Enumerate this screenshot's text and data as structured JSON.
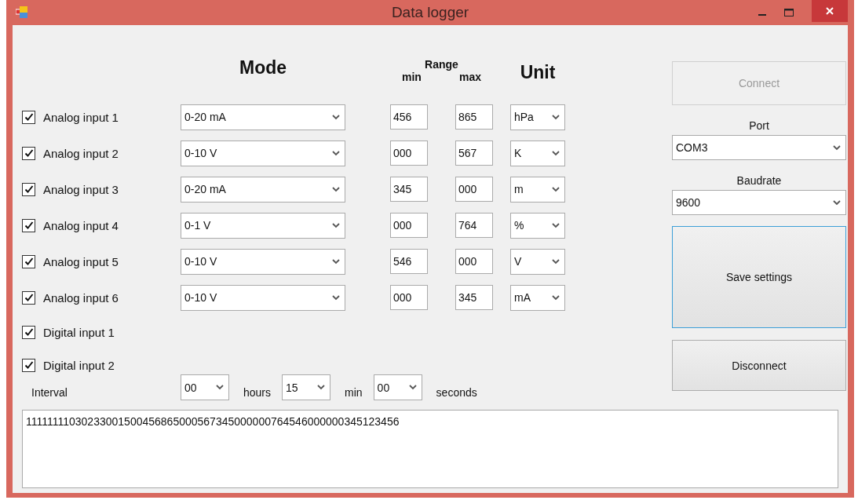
{
  "window": {
    "title": "Data logger"
  },
  "headers": {
    "mode": "Mode",
    "range": "Range",
    "min": "min",
    "max": "max",
    "unit": "Unit"
  },
  "inputs": [
    {
      "kind": "analog",
      "label": "Analog input 1",
      "checked": true,
      "mode": "0-20 mA",
      "min": "456",
      "max": "865",
      "unit": "hPa"
    },
    {
      "kind": "analog",
      "label": "Analog input 2",
      "checked": true,
      "mode": "0-10 V",
      "min": "000",
      "max": "567",
      "unit": "K"
    },
    {
      "kind": "analog",
      "label": "Analog input 3",
      "checked": true,
      "mode": "0-20 mA",
      "min": "345",
      "max": "000",
      "unit": "m"
    },
    {
      "kind": "analog",
      "label": "Analog input 4",
      "checked": true,
      "mode": "0-1 V",
      "min": "000",
      "max": "764",
      "unit": "%"
    },
    {
      "kind": "analog",
      "label": "Analog input 5",
      "checked": true,
      "mode": "0-10 V",
      "min": "546",
      "max": "000",
      "unit": "V"
    },
    {
      "kind": "analog",
      "label": "Analog input 6",
      "checked": true,
      "mode": "0-10 V",
      "min": "000",
      "max": "345",
      "unit": "mA"
    },
    {
      "kind": "digital",
      "label": "Digital input 1",
      "checked": true
    },
    {
      "kind": "digital",
      "label": "Digital input 2",
      "checked": true
    }
  ],
  "interval": {
    "label": "Interval",
    "parts": [
      {
        "value": "00",
        "unit": "hours"
      },
      {
        "value": "15",
        "unit": "min"
      },
      {
        "value": "00",
        "unit": "seconds"
      }
    ]
  },
  "connect": {
    "label": "Connect",
    "disabled": true
  },
  "port": {
    "label": "Port",
    "value": "COM3"
  },
  "baudrate": {
    "label": "Baudrate",
    "value": "9600"
  },
  "save": {
    "label": "Save settings",
    "focused": true
  },
  "disconnect": {
    "label": "Disconnect",
    "disabled": false
  },
  "log": "11111111030233001500456865000567345000000764546000000345123456"
}
